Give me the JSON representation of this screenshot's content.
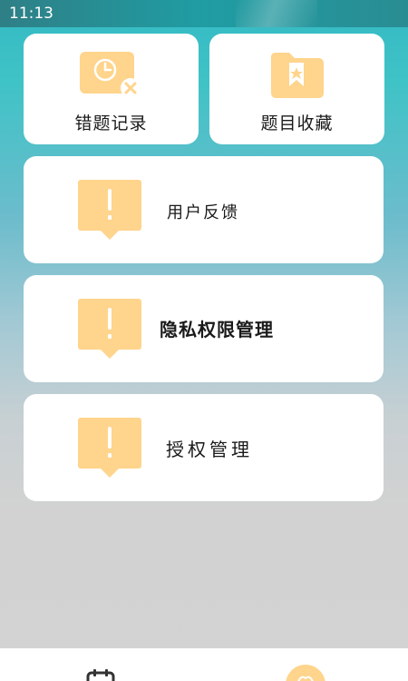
{
  "status_bar": {
    "time": "11:13"
  },
  "cards": {
    "wrong_records": {
      "label": "错题记录",
      "icon": "clock-cross-icon"
    },
    "favorites": {
      "label": "题目收藏",
      "icon": "folder-star-icon"
    }
  },
  "rows": [
    {
      "label": "用户反馈",
      "icon": "alert-bubble-icon"
    },
    {
      "label": "隐私权限管理",
      "icon": "alert-bubble-icon"
    },
    {
      "label": "授权管理",
      "icon": "alert-bubble-icon"
    }
  ],
  "bottom_nav": {
    "items": [
      {
        "icon": "calendar-icon"
      },
      {
        "icon": "flower-icon"
      }
    ]
  },
  "colors": {
    "accent": "#ffd48c",
    "card": "#ffffff",
    "text": "#1a1a1a"
  }
}
